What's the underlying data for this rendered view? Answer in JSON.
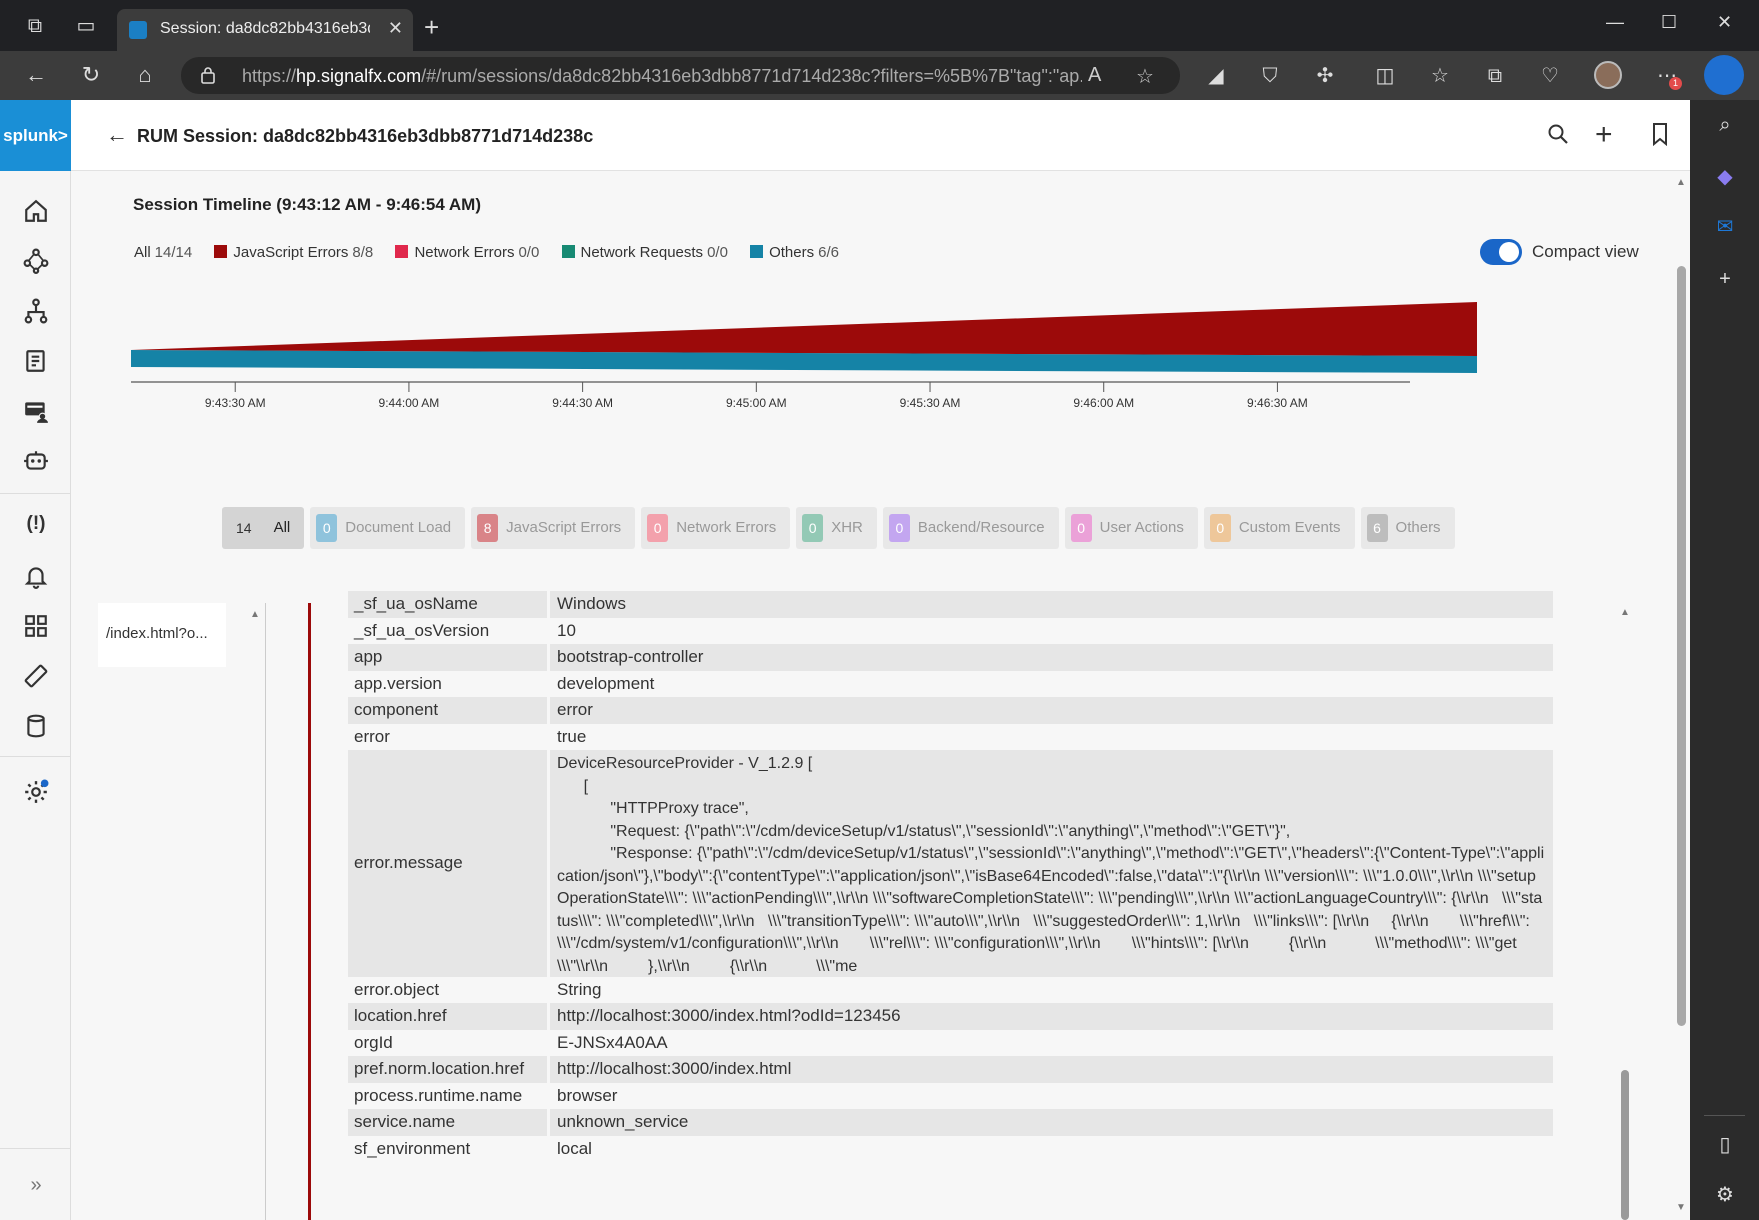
{
  "browser": {
    "tab_title": "Session: da8dc82bb4316eb3dbb",
    "url_prefix": "https://",
    "url_host": "hp.signalfx.com",
    "url_rest": "/#/rum/sessions/da8dc82bb4316eb3dbb8771d714d238c?filters=%5B%7B\"tag\":\"ap...",
    "notification_badge": "1"
  },
  "nav": {
    "logo": "splunk>"
  },
  "header": {
    "title": "RUM Session: da8dc82bb4316eb3dbb8771d714d238c"
  },
  "timeline": {
    "title": "Session Timeline (9:43:12 AM - 9:46:54 AM)",
    "compact_label": "Compact view",
    "compact_on": true,
    "legend": [
      {
        "label": "All",
        "count": "14/14",
        "color": ""
      },
      {
        "label": "JavaScript Errors",
        "count": "8/8",
        "color": "#9c0a0a"
      },
      {
        "label": "Network Errors",
        "count": "0/0",
        "color": "#e0284c"
      },
      {
        "label": "Network Requests",
        "count": "0/0",
        "color": "#178a73"
      },
      {
        "label": "Others",
        "count": "6/6",
        "color": "#1583a6"
      }
    ]
  },
  "chart_data": {
    "type": "area",
    "x": [
      "9:43:12 AM",
      "9:46:54 AM"
    ],
    "series": [
      {
        "name": "Others",
        "values": [
          6,
          6
        ],
        "color": "#1583a6"
      },
      {
        "name": "JavaScript Errors",
        "values": [
          0,
          8
        ],
        "color": "#9c0a0a"
      }
    ],
    "tick_labels": [
      "9:43:30 AM",
      "9:44:00 AM",
      "9:44:30 AM",
      "9:45:00 AM",
      "9:45:30 AM",
      "9:46:00 AM",
      "9:46:30 AM"
    ],
    "xlim_seconds_after_start": [
      0,
      222
    ],
    "tick_seconds_after_start": [
      18,
      48,
      78,
      108,
      138,
      168,
      198
    ],
    "legend_position": "top-left",
    "grid": false
  },
  "filters": [
    {
      "count": "14",
      "label": "All",
      "color": "",
      "active": true
    },
    {
      "count": "0",
      "label": "Document Load",
      "color": "#8fc3dc",
      "active": false
    },
    {
      "count": "8",
      "label": "JavaScript Errors",
      "color": "#d98488",
      "active": false
    },
    {
      "count": "0",
      "label": "Network Errors",
      "color": "#f3a1ac",
      "active": false
    },
    {
      "count": "0",
      "label": "XHR",
      "color": "#93c9b5",
      "active": false
    },
    {
      "count": "0",
      "label": "Backend/Resource",
      "color": "#c3a6f0",
      "active": false
    },
    {
      "count": "0",
      "label": "User Actions",
      "color": "#eba1d8",
      "active": false
    },
    {
      "count": "0",
      "label": "Custom Events",
      "color": "#eec79a",
      "active": false
    },
    {
      "count": "6",
      "label": "Others",
      "color": "#bdbdbd",
      "active": false
    }
  ],
  "event_list": {
    "item": "/index.html?o..."
  },
  "attributes": [
    {
      "key": "_sf_ua_osName",
      "value": "Windows"
    },
    {
      "key": "_sf_ua_osVersion",
      "value": "10"
    },
    {
      "key": "app",
      "value": "bootstrap-controller"
    },
    {
      "key": "app.version",
      "value": "development"
    },
    {
      "key": "component",
      "value": "error"
    },
    {
      "key": "error",
      "value": "true"
    },
    {
      "key": "error.message",
      "value": "DeviceResourceProvider - V_1.2.9 [\n      [\n            \"HTTPProxy trace\",\n            \"Request: {\\\"path\\\":\\\"/cdm/deviceSetup/v1/status\\\",\\\"sessionId\\\":\\\"anything\\\",\\\"method\\\":\\\"GET\\\"}\",\n            \"Response: {\\\"path\\\":\\\"/cdm/deviceSetup/v1/status\\\",\\\"sessionId\\\":\\\"anything\\\",\\\"method\\\":\\\"GET\\\",\\\"headers\\\":{\\\"Content-Type\\\":\\\"application/json\\\"},\\\"body\\\":{\\\"contentType\\\":\\\"application/json\\\",\\\"isBase64Encoded\\\":false,\\\"data\\\":\\\"{\\\\r\\\\n \\\\\\\"version\\\\\\\": \\\\\\\"1.0.0\\\\\\\",\\\\r\\\\n \\\\\\\"setupOperationState\\\\\\\": \\\\\\\"actionPending\\\\\\\",\\\\r\\\\n \\\\\\\"softwareCompletionState\\\\\\\": \\\\\\\"pending\\\\\\\",\\\\r\\\\n \\\\\\\"actionLanguageCountry\\\\\\\": {\\\\r\\\\n   \\\\\\\"status\\\\\\\": \\\\\\\"completed\\\\\\\",\\\\r\\\\n   \\\\\\\"transitionType\\\\\\\": \\\\\\\"auto\\\\\\\",\\\\r\\\\n   \\\\\\\"suggestedOrder\\\\\\\": 1,\\\\r\\\\n   \\\\\\\"links\\\\\\\": [\\\\r\\\\n     {\\\\r\\\\n       \\\\\\\"href\\\\\\\": \\\\\\\"/cdm/system/v1/configuration\\\\\\\",\\\\r\\\\n       \\\\\\\"rel\\\\\\\": \\\\\\\"configuration\\\\\\\",\\\\r\\\\n       \\\\\\\"hints\\\\\\\": [\\\\r\\\\n         {\\\\r\\\\n           \\\\\\\"method\\\\\\\": \\\\\\\"get\\\\\\\"\\\\r\\\\n         },\\\\r\\\\n         {\\\\r\\\\n           \\\\\\\"me"
    },
    {
      "key": "error.object",
      "value": "String"
    },
    {
      "key": "location.href",
      "value": "http://localhost:3000/index.html?odId=123456"
    },
    {
      "key": "orgId",
      "value": "E-JNSx4A0AA"
    },
    {
      "key": "pref.norm.location.href",
      "value": "http://localhost:3000/index.html"
    },
    {
      "key": "process.runtime.name",
      "value": "browser"
    },
    {
      "key": "service.name",
      "value": "unknown_service"
    },
    {
      "key": "sf_environment",
      "value": "local"
    }
  ]
}
